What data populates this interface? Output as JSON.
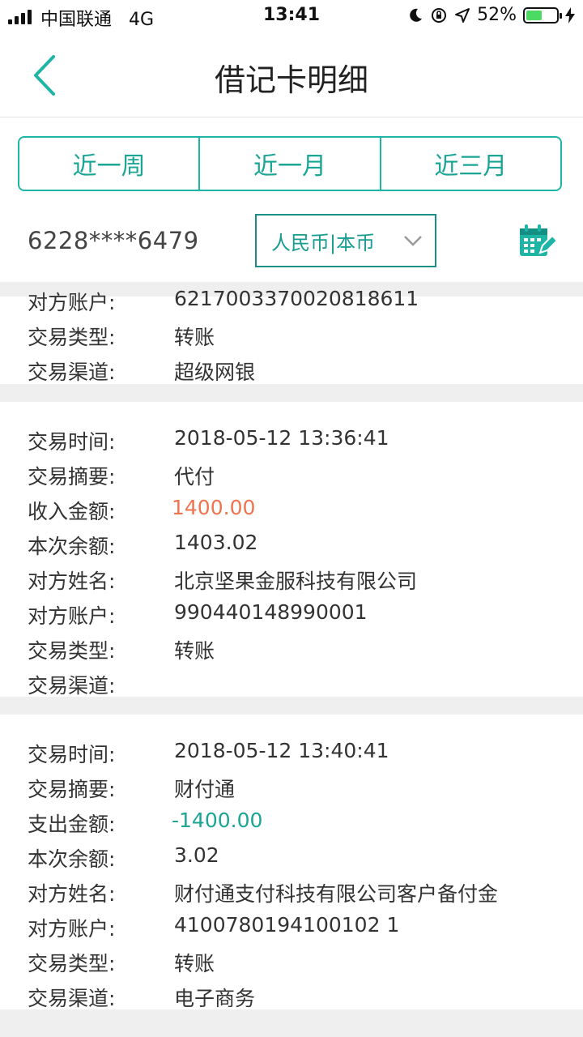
{
  "status_bar": {
    "carrier": "中国联通",
    "network": "4G",
    "time": "13:41",
    "battery": "52%",
    "battery_level": 0.52
  },
  "header": {
    "title": "借记卡明细",
    "back_icon": "chevron-left-icon"
  },
  "tabs": [
    {
      "label": "近一周"
    },
    {
      "label": "近一月"
    },
    {
      "label": "近三月"
    }
  ],
  "account": {
    "number": "6228****6479",
    "currency": "人民币|本币",
    "calendar_icon": "calendar-edit-icon"
  },
  "transactions": [
    {
      "fields": [
        {
          "key": "对方账户:",
          "value": "6217003370020818611",
          "type": "normal"
        },
        {
          "key": "交易类型:",
          "value": "转账",
          "type": "normal"
        },
        {
          "key": "交易渠道:",
          "value": "超级网银",
          "type": "normal"
        }
      ]
    },
    {
      "fields": [
        {
          "key": "交易时间:",
          "value": "2018-05-12 13:36:41",
          "type": "normal"
        },
        {
          "key": "交易摘要:",
          "value": "代付",
          "type": "normal"
        },
        {
          "key": "收入金额:",
          "value": "1400.00",
          "type": "income"
        },
        {
          "key": "本次余额:",
          "value": "1403.02",
          "type": "normal"
        },
        {
          "key": "对方姓名:",
          "value": "北京坚果金服科技有限公司",
          "type": "normal"
        },
        {
          "key": "对方账户:",
          "value": "990440148990001",
          "type": "normal"
        },
        {
          "key": "交易类型:",
          "value": "转账",
          "type": "normal"
        },
        {
          "key": "交易渠道:",
          "value": "",
          "type": "normal"
        }
      ]
    },
    {
      "fields": [
        {
          "key": "交易时间:",
          "value": "2018-05-12 13:40:41",
          "type": "normal"
        },
        {
          "key": "交易摘要:",
          "value": "财付通",
          "type": "normal"
        },
        {
          "key": "支出金额:",
          "value": "-1400.00",
          "type": "expense"
        },
        {
          "key": "本次余额:",
          "value": "3.02",
          "type": "normal"
        },
        {
          "key": "对方姓名:",
          "value": "财付通支付科技有限公司客户备付金",
          "type": "normal"
        },
        {
          "key": "对方账户:",
          "value": "4100780194100102 1",
          "type": "normal"
        },
        {
          "key": "交易类型:",
          "value": "转账",
          "type": "normal"
        },
        {
          "key": "交易渠道:",
          "value": "电子商务",
          "type": "normal"
        }
      ]
    }
  ],
  "colors": {
    "accent": "#1fb5a5",
    "income": "#f0734f",
    "expense": "#1aa595"
  }
}
